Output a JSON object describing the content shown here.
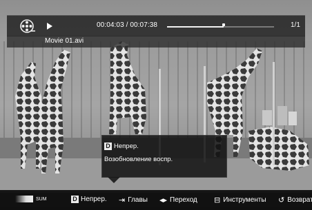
{
  "player": {
    "time": "00:04:03 / 00:07:38",
    "progress": 0.53,
    "page_count": "1/1",
    "file_name": "Movie 01.avi"
  },
  "popup": {
    "key": "D",
    "title": "Непрер.",
    "subtitle": "Возобновление воспр."
  },
  "bottom_bar": {
    "sum_label": "SUM",
    "resume_key": "D",
    "resume_label": "Непрер.",
    "chapters_label": "Главы",
    "jump_label": "Переход",
    "tools_label": "Инструменты",
    "return_label": "Возврат"
  },
  "colors": {
    "bar_background": "#191919",
    "text": "#ffffff",
    "progress_track": "#7a7a7a",
    "progress_fill": "#f2f2f2"
  },
  "icons": [
    "film-reel-icon",
    "play-icon",
    "chapters-icon",
    "left-right-arrows-icon",
    "tools-icon",
    "return-icon"
  ]
}
